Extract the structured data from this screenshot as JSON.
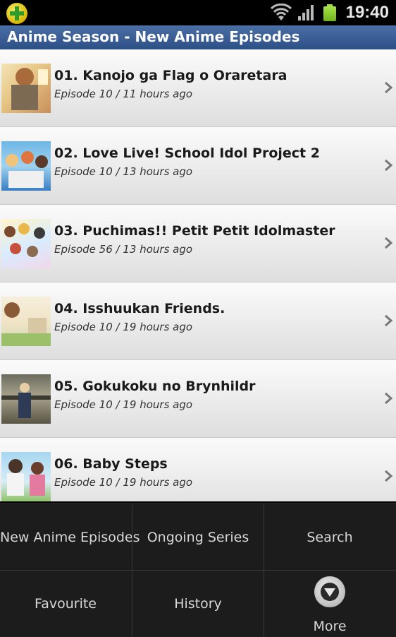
{
  "status_bar": {
    "time": "19:40"
  },
  "app_bar": {
    "title": "Anime Season - New Anime Episodes"
  },
  "episodes": [
    {
      "title": "01. Kanojo ga Flag o Oraretara",
      "subtitle": "Episode 10 / 11 hours ago"
    },
    {
      "title": "02. Love Live! School Idol Project 2",
      "subtitle": "Episode 10 / 13 hours ago"
    },
    {
      "title": "03. Puchimas!! Petit Petit Idolmaster",
      "subtitle": "Episode 56 / 13 hours ago"
    },
    {
      "title": "04. Isshuukan Friends.",
      "subtitle": "Episode 10 / 19 hours ago"
    },
    {
      "title": "05. Gokukoku no Brynhildr",
      "subtitle": "Episode 10 / 19 hours ago"
    },
    {
      "title": "06. Baby Steps",
      "subtitle": "Episode 10 / 19 hours ago"
    }
  ],
  "menu": {
    "new_episodes": "New Anime Episodes",
    "ongoing": "Ongoing Series",
    "search": "Search",
    "favourite": "Favourite",
    "history": "History",
    "more": "More"
  },
  "colors": {
    "title_bar": "#2c4f86",
    "menu_bg": "#1c1c1c",
    "battery": "#8fd22e"
  }
}
